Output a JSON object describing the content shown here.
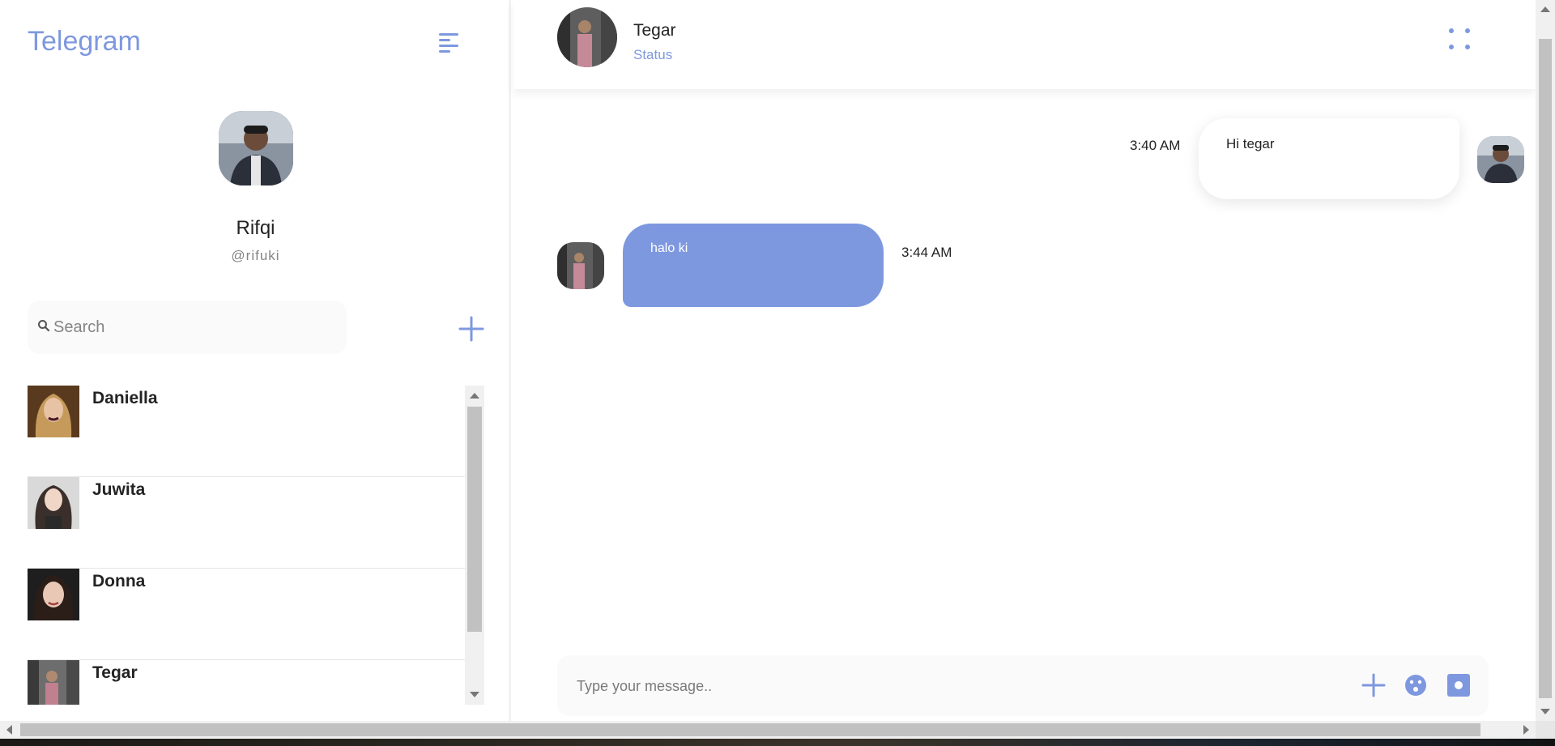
{
  "sidebar": {
    "app_title": "Telegram",
    "menu_icon": "hamburger-menu-icon",
    "profile": {
      "name": "Rifqi",
      "handle": "@rifuki"
    },
    "search": {
      "placeholder": "Search",
      "value": ""
    },
    "add_icon": "plus-icon",
    "contacts": [
      {
        "name": "Daniella"
      },
      {
        "name": "Juwita"
      },
      {
        "name": "Donna"
      },
      {
        "name": "Tegar"
      }
    ]
  },
  "chat": {
    "header": {
      "name": "Tegar",
      "status": "Status"
    },
    "messages": [
      {
        "direction": "outgoing",
        "text": "Hi tegar",
        "time": "3:40 AM"
      },
      {
        "direction": "incoming",
        "text": "halo ki",
        "time": "3:44 AM"
      }
    ],
    "composer": {
      "placeholder": "Type your message..",
      "value": ""
    }
  },
  "colors": {
    "accent": "#7e98df",
    "text": "#232323",
    "muted": "#848484",
    "input_bg": "#fafafa"
  }
}
